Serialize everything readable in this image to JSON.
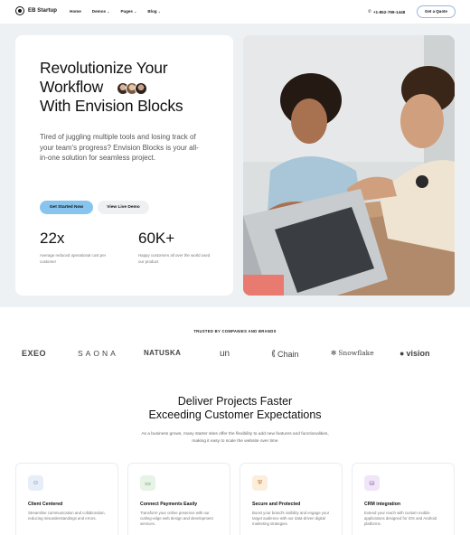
{
  "nav": {
    "logo": "EB Startup",
    "menu": [
      "Home",
      "Demos",
      "Pages",
      "Blog"
    ],
    "phone": "+1-852-799-1448",
    "cta": "Get a Quote"
  },
  "hero": {
    "title_line1": "Revolutionize Your",
    "title_line2": "Workflow",
    "title_line3": "With Envision Blocks",
    "lead": "Tired of juggling multiple tools and losing track of your team's progress? Envision Blocks is your all-in-one solution for seamless project.",
    "primary_button": "Get Started Now",
    "secondary_button": "View Live Demo",
    "stats": [
      {
        "value": "22x",
        "label": "Average reduced operational cost per customer"
      },
      {
        "value": "60K+",
        "label": "Happy customers all over the world used our product"
      }
    ]
  },
  "trusted": {
    "label": "TRUSTED BY COMPANIES AND BRANDS",
    "brands": [
      "EXEO",
      "SAONA",
      "NATUSKA",
      "un",
      "Chain",
      "Snowflake",
      "vision"
    ]
  },
  "section2": {
    "title_line1": "Deliver Projects Faster",
    "title_line2": "Exceeding Customer Expectations",
    "subtitle": "As a business grows, many starter sites offer the flexibility to add new features and functionalities, making it easy to scale the website over time",
    "features": [
      {
        "title": "Client Centered",
        "desc": "Streamline communication and collaboration, reducing misunderstandings and errors."
      },
      {
        "title": "Connect Payments Easily",
        "desc": "Transform your online presence with our cutting-edge web design and development services."
      },
      {
        "title": "Secure and Protected",
        "desc": "Boost your brand's visibility and engage your target audience with our data-driven digital marketing strategies."
      },
      {
        "title": "CRM integration",
        "desc": "Extend your reach with custom mobile applications designed for iOS and Android platforms."
      }
    ]
  },
  "colors": {
    "primary_button": "#87c5ef",
    "hero_bg": "#eef1f4"
  }
}
